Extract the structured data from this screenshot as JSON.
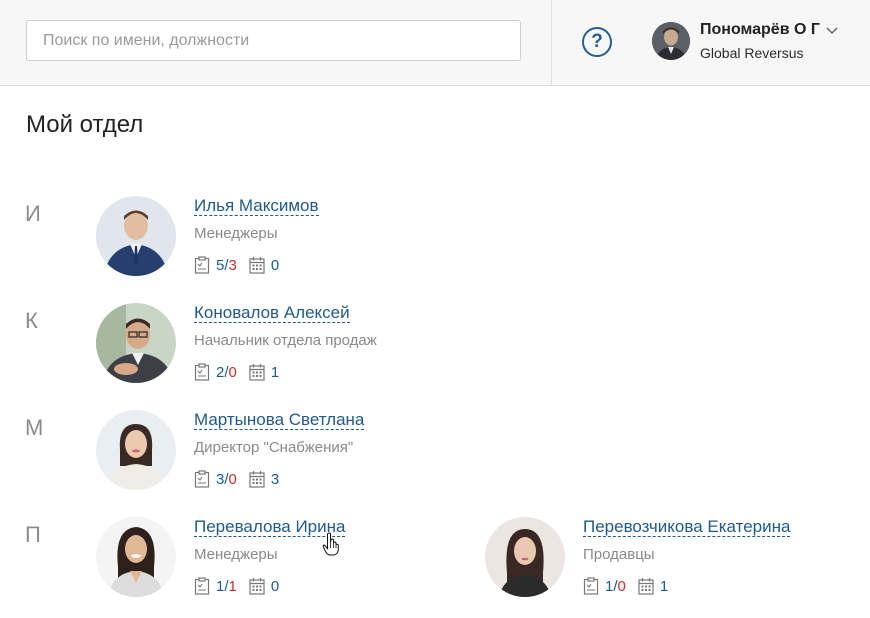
{
  "header": {
    "search_placeholder": "Поиск по имени, должности",
    "user_name": "Пономарёв О Г",
    "user_company": "Global Reversus",
    "help_label": "?"
  },
  "page": {
    "title": "Мой отдел"
  },
  "letters": [
    "И",
    "К",
    "М",
    "П"
  ],
  "people": [
    {
      "name": "Илья Максимов",
      "role": "Менеджеры",
      "tasks_done": "5",
      "tasks_overdue": "3",
      "events": "0"
    },
    {
      "name": "Коновалов Алексей",
      "role": "Начальник отдела продаж",
      "tasks_done": "2",
      "tasks_overdue": "0",
      "events": "1"
    },
    {
      "name": "Мартынова Светлана",
      "role": "Директор \"Снабжения\"",
      "tasks_done": "3",
      "tasks_overdue": "0",
      "events": "3"
    },
    {
      "name": "Перевалова Ирина",
      "role": "Менеджеры",
      "tasks_done": "1",
      "tasks_overdue": "1",
      "events": "0"
    },
    {
      "name": "Перевозчикова Екатерина",
      "role": "Продавцы",
      "tasks_done": "1",
      "tasks_overdue": "0",
      "events": "1"
    }
  ],
  "colors": {
    "link": "#1f5a8d",
    "overdue": "#d32a2a",
    "muted": "#8a8a8a"
  },
  "icons": {
    "tasks": "clipboard-icon",
    "events": "calendar-icon",
    "help": "question-circle-icon",
    "menu": "chevron-down-icon"
  }
}
